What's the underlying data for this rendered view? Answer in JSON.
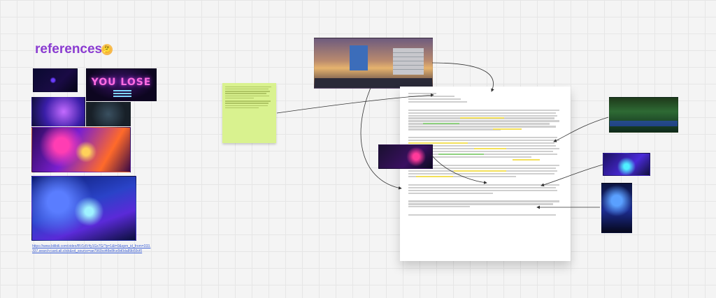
{
  "board": {
    "heading": "references",
    "heading_emoji": "🤔",
    "thumb_text": "YOU LOSE",
    "reference_link": "https://www.bilibili.com/video/BV1dV4y1Gx7G/?p=1&t=0&spm_id_from=333.337.search-card.all.click&vd_source=ae7960cd48e8fce9d0da89b59cf0"
  },
  "sticky_note": {
    "title": "",
    "subtitle": ""
  },
  "document": {
    "header_lines": [],
    "paragraph_count": 9
  },
  "colors": {
    "heading": "#8a3bd1",
    "sticky": "#d9f28f",
    "link": "#3c5fd6",
    "highlight_yellow": "#f3e05a",
    "highlight_green": "#8ed07e"
  }
}
